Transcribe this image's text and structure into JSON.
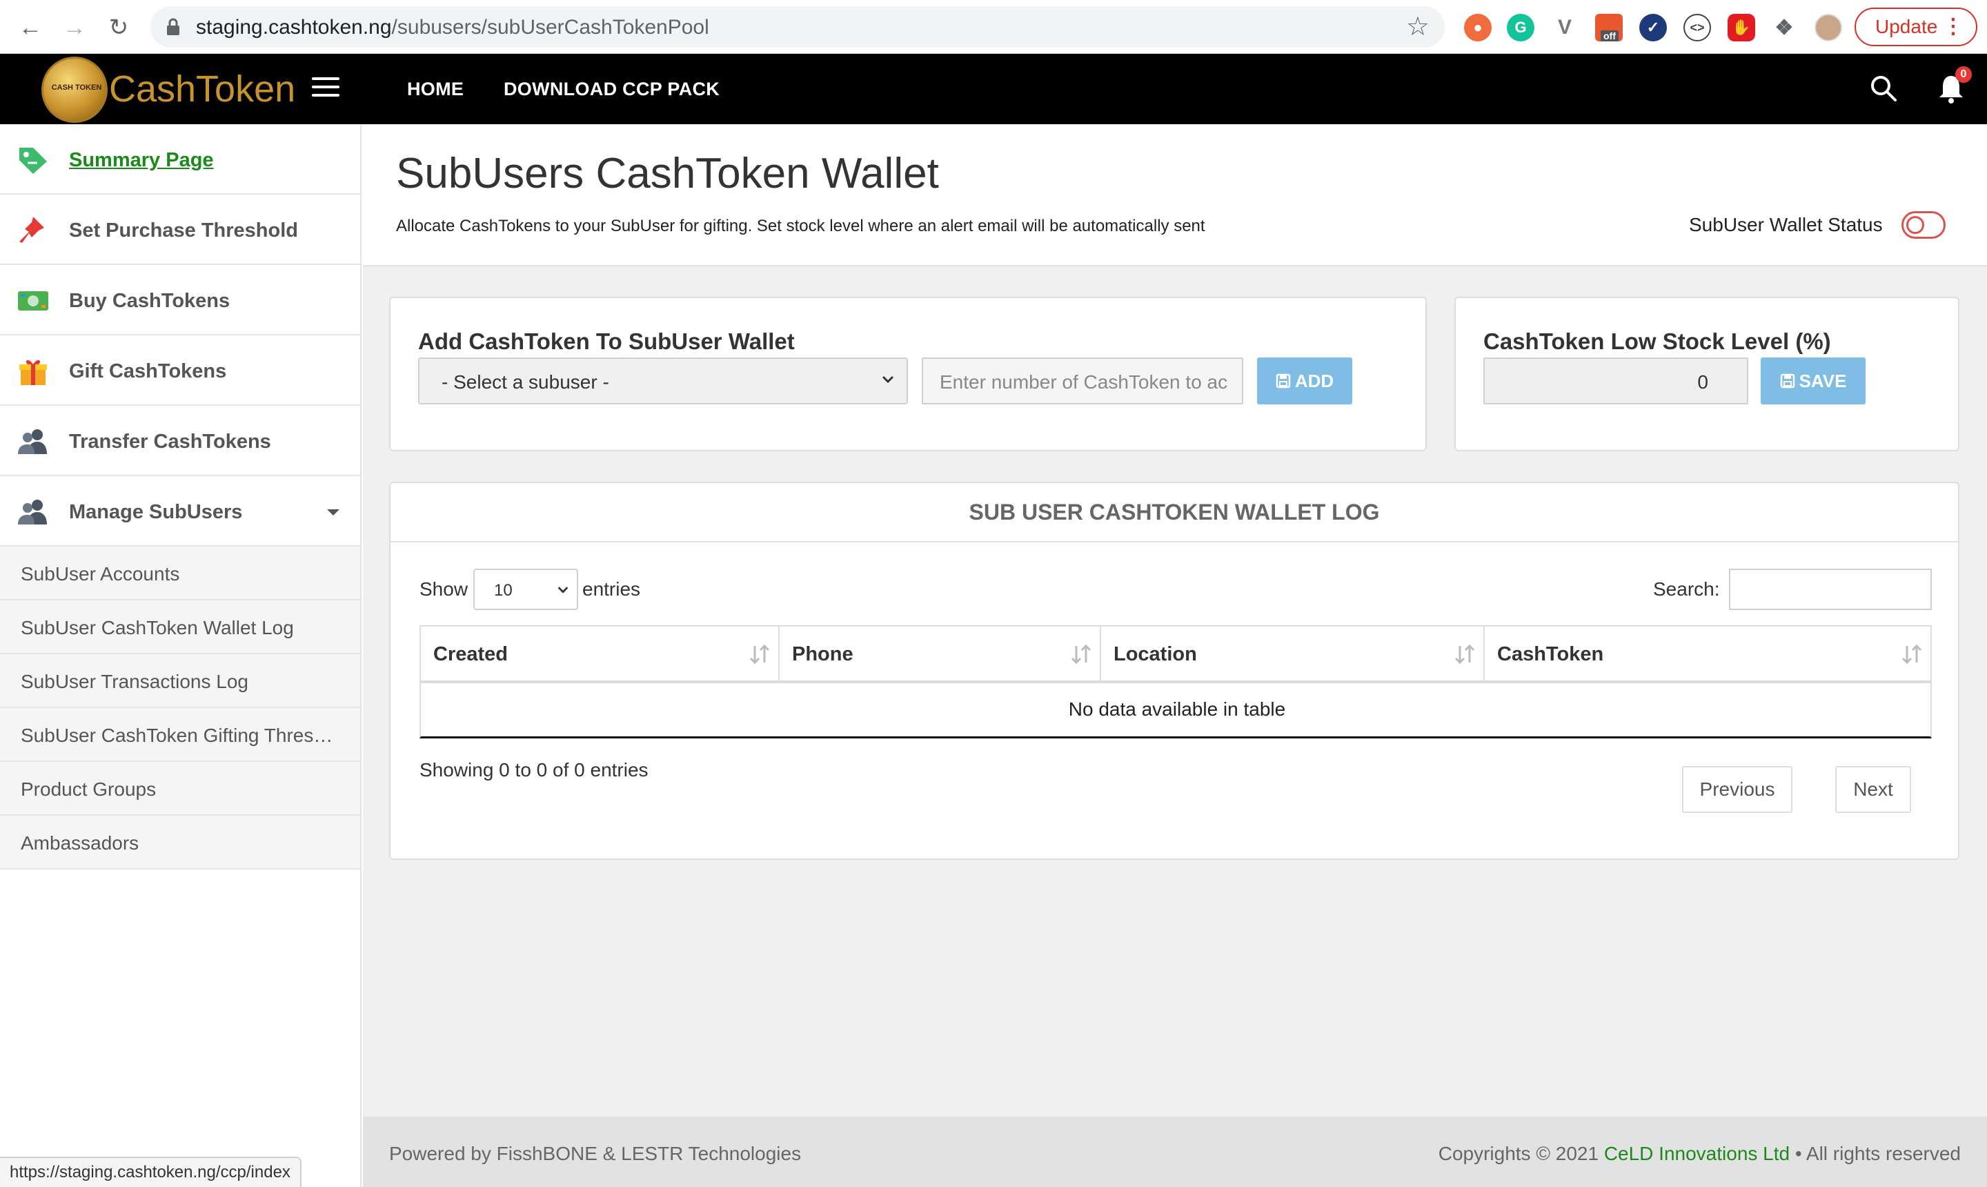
{
  "browser": {
    "url_host": "staging.cashtoken.ng",
    "url_path": "/subusers/subUserCashTokenPool",
    "update_label": "Update",
    "extension_badge": "off",
    "status_url": "https://staging.cashtoken.ng/ccp/index"
  },
  "topnav": {
    "logo_text": "CashToken",
    "logo_coin_label": "CASH TOKEN",
    "links": [
      "HOME",
      "DOWNLOAD CCP PACK"
    ],
    "notification_count": "0"
  },
  "sidebar": {
    "items": [
      {
        "label": "Summary Page",
        "icon": "price-tag-icon"
      },
      {
        "label": "Set Purchase Threshold",
        "icon": "pushpin-icon"
      },
      {
        "label": "Buy CashTokens",
        "icon": "banknote-icon"
      },
      {
        "label": "Gift CashTokens",
        "icon": "gift-icon"
      },
      {
        "label": "Transfer CashTokens",
        "icon": "users-icon"
      },
      {
        "label": "Manage SubUsers",
        "icon": "users-icon"
      }
    ],
    "subitems": [
      "SubUser Accounts",
      "SubUser CashToken Wallet Log",
      "SubUser Transactions Log",
      "SubUser CashToken Gifting Thres…",
      "Product Groups",
      "Ambassadors"
    ]
  },
  "header": {
    "title": "SubUsers CashToken Wallet",
    "subtitle": "Allocate CashTokens to your SubUser for gifting. Set stock level where an alert email will be automatically sent",
    "wallet_status_label": "SubUser Wallet Status",
    "wallet_status_on": false
  },
  "add_card": {
    "title": "Add CashToken To SubUser Wallet",
    "select_value": "- Select a subuser -",
    "input_placeholder": "Enter number of CashToken to ac",
    "add_label": "ADD"
  },
  "low_stock_card": {
    "title": "CashToken Low Stock Level (%)",
    "value": "0",
    "save_label": "SAVE"
  },
  "log": {
    "title": "SUB USER CASHTOKEN WALLET LOG",
    "show_label": "Show",
    "entries_value": "10",
    "entries_label": "entries",
    "search_label": "Search:",
    "columns": [
      "Created",
      "Phone",
      "Location",
      "CashToken"
    ],
    "empty_text": "No data available in table",
    "showing_info": "Showing 0 to 0 of 0 entries",
    "previous_label": "Previous",
    "next_label": "Next"
  },
  "footer": {
    "left": "Powered by FisshBONE & LESTR Technologies",
    "right_prefix": "Copyrights © 2021 ",
    "company": "CeLD Innovations Ltd",
    "right_suffix": " • All rights reserved"
  },
  "colors": {
    "nav_bg": "#000000",
    "brand_gold": "#c6932c",
    "active_link": "#1a8a1a",
    "button_blue": "#7fbce6",
    "toggle_red": "#d9534f"
  }
}
